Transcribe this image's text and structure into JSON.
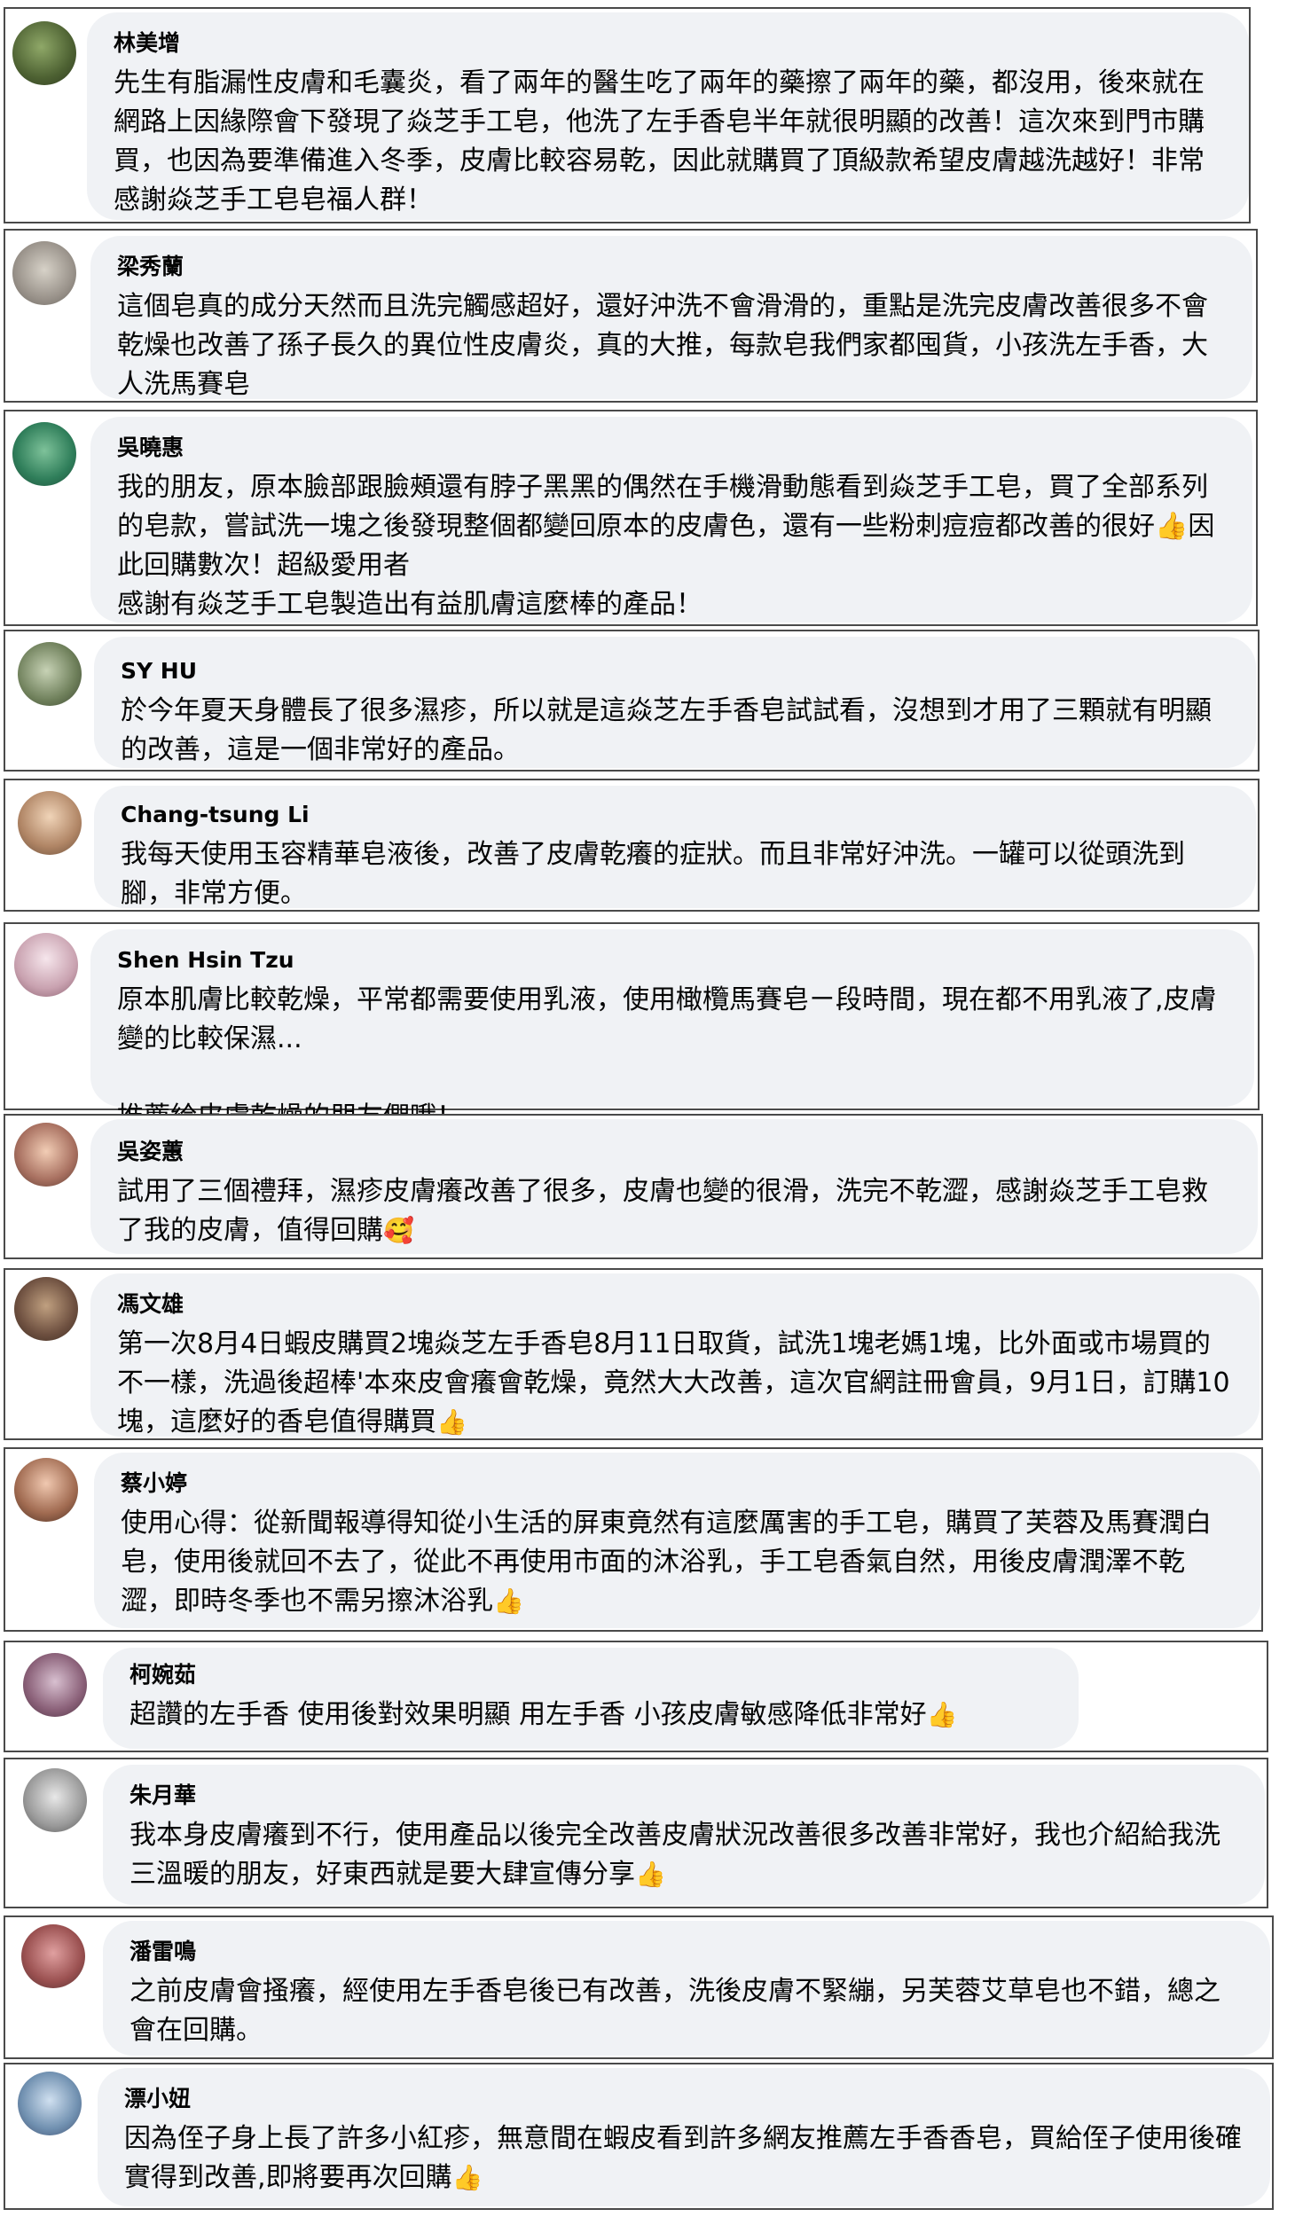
{
  "comments": [
    {
      "name": "林美增",
      "text": "先生有脂漏性皮膚和毛囊炎，看了兩年的醫生吃了兩年的藥擦了兩年的藥，都沒用，後來就在網路上因緣際會下發現了焱芝手工皂，他洗了左手香皂半年就很明顯的改善！這次來到門市購買，也因為要準備進入冬季，皮膚比較容易乾，因此就購買了頂級款希望皮膚越洗越好！非常感謝焱芝手工皂皂福人群！",
      "emoji": ""
    },
    {
      "name": "梁秀蘭",
      "text": "這個皂真的成分天然而且洗完觸感超好，還好沖洗不會滑滑的，重點是洗完皮膚改善很多不會乾燥也改善了孫子長久的異位性皮膚炎，真的大推，每款皂我們家都囤貨，小孩洗左手香，大人洗馬賽皂",
      "emoji": ""
    },
    {
      "name": "吳曉惠",
      "text": "我的朋友，原本臉部跟臉頰還有脖子黑黑的偶然在手機滑動態看到焱芝手工皂，買了全部系列的皂款，嘗試洗一塊之後發現整個都變回原本的皮膚色，還有一些粉刺痘痘都改善的很好👍因此回購數次！超級愛用者\n感謝有焱芝手工皂製造出有益肌膚這麼棒的產品！",
      "emoji": ""
    },
    {
      "name": "SY HU",
      "text": "於今年夏天身體長了很多濕疹，所以就是這焱芝左手香皂試試看，沒想到才用了三顆就有明顯的改善，這是一個非常好的產品。",
      "emoji": ""
    },
    {
      "name": "Chang-tsung Li",
      "text": "我每天使用玉容精華皂液後，改善了皮膚乾癢的症狀。而且非常好沖洗。一罐可以從頭洗到腳，非常方便。",
      "emoji": ""
    },
    {
      "name": "Shen Hsin Tzu",
      "text": "原本肌膚比較乾燥，平常都需要使用乳液，使用橄欖馬賽皂ㄧ段時間，現在都不用乳液了,皮膚變的比較保濕...\n\n推薦給皮膚乾燥的朋友們哦！",
      "emoji": ""
    },
    {
      "name": "吳姿蕙",
      "text": "試用了三個禮拜，濕疹皮膚癢改善了很多，皮膚也變的很滑，洗完不乾澀，感謝焱芝手工皂救了我的皮膚，值得回購",
      "emoji": "🥰"
    },
    {
      "name": "馮文雄",
      "text": "第一次8月4日蝦皮購買2塊焱芝左手香皂8月11日取貨，試洗1塊老媽1塊，比外面或市場買的不一樣，洗過後超棒'本來皮會癢會乾燥，竟然大大改善，這次官網註冊會員，9月1日，訂購10塊，這麼好的香皂值得購買",
      "emoji": "👍"
    },
    {
      "name": "蔡小婷",
      "text": "使用心得：從新聞報導得知從小生活的屏東竟然有這麼厲害的手工皂，購買了芙蓉及馬賽潤白皂，使用後就回不去了，從此不再使用市面的沐浴乳，手工皂香氣自然，用後皮膚潤澤不乾澀，即時冬季也不需另擦沐浴乳",
      "emoji": "👍"
    },
    {
      "name": "柯婉茹",
      "text": "超讚的左手香 使用後對效果明顯 用左手香 小孩皮膚敏感降低非常好",
      "emoji": "👍"
    },
    {
      "name": "朱月華",
      "text": "我本身皮膚癢到不行，使用產品以後完全改善皮膚狀況改善很多改善非常好，我也介紹給我洗三溫暖的朋友，好東西就是要大肆宣傳分享",
      "emoji": "👍"
    },
    {
      "name": "潘雷鳴",
      "text": "之前皮膚會搔癢，經使用左手香皂後已有改善，洗後皮膚不緊繃，另芙蓉艾草皂也不錯，總之會在回購。",
      "emoji": ""
    },
    {
      "name": "漂小妞",
      "text": "因為侄子身上長了許多小紅疹，無意間在蝦皮看到許多網友推薦左手香香皂，買給侄子使用後確實得到改善,即將要再次回購",
      "emoji": "👍"
    }
  ]
}
